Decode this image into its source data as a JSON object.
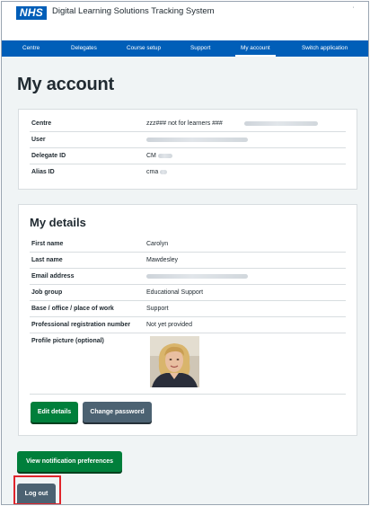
{
  "header": {
    "logo_text": "NHS",
    "service_name": "Digital Learning Solutions Tracking System",
    "corner_mark": "'"
  },
  "nav": {
    "items": [
      {
        "label": "Centre",
        "active": false
      },
      {
        "label": "Delegates",
        "active": false
      },
      {
        "label": "Course setup",
        "active": false
      },
      {
        "label": "Support",
        "active": false
      },
      {
        "label": "My account",
        "active": true
      },
      {
        "label": "Switch application",
        "active": false
      }
    ]
  },
  "page": {
    "title": "My account"
  },
  "account_summary": {
    "rows": [
      {
        "key": "Centre",
        "value": "zzz### not for learners ###"
      },
      {
        "key": "User",
        "value": ""
      },
      {
        "key": "Delegate ID",
        "value": "CM"
      },
      {
        "key": "Alias ID",
        "value": "cma"
      }
    ]
  },
  "my_details": {
    "heading": "My details",
    "rows": [
      {
        "key": "First name",
        "value": "Carolyn"
      },
      {
        "key": "Last name",
        "value": "Mawdesley"
      },
      {
        "key": "Email address",
        "value": ""
      },
      {
        "key": "Job group",
        "value": "Educational Support"
      },
      {
        "key": "Base / office / place of work",
        "value": "Support"
      },
      {
        "key": "Professional registration number",
        "value": "Not yet provided"
      },
      {
        "key": "Profile picture (optional)",
        "value": ""
      }
    ],
    "edit_button": "Edit details",
    "change_password_button": "Change password"
  },
  "actions": {
    "notification_button": "View notification preferences",
    "logout_button": "Log out"
  },
  "colors": {
    "nhs_blue": "#005eb8",
    "page_background": "#f0f4f5",
    "primary_button": "#007f3b",
    "secondary_button": "#4c6272",
    "highlight_border": "#e0242b"
  }
}
